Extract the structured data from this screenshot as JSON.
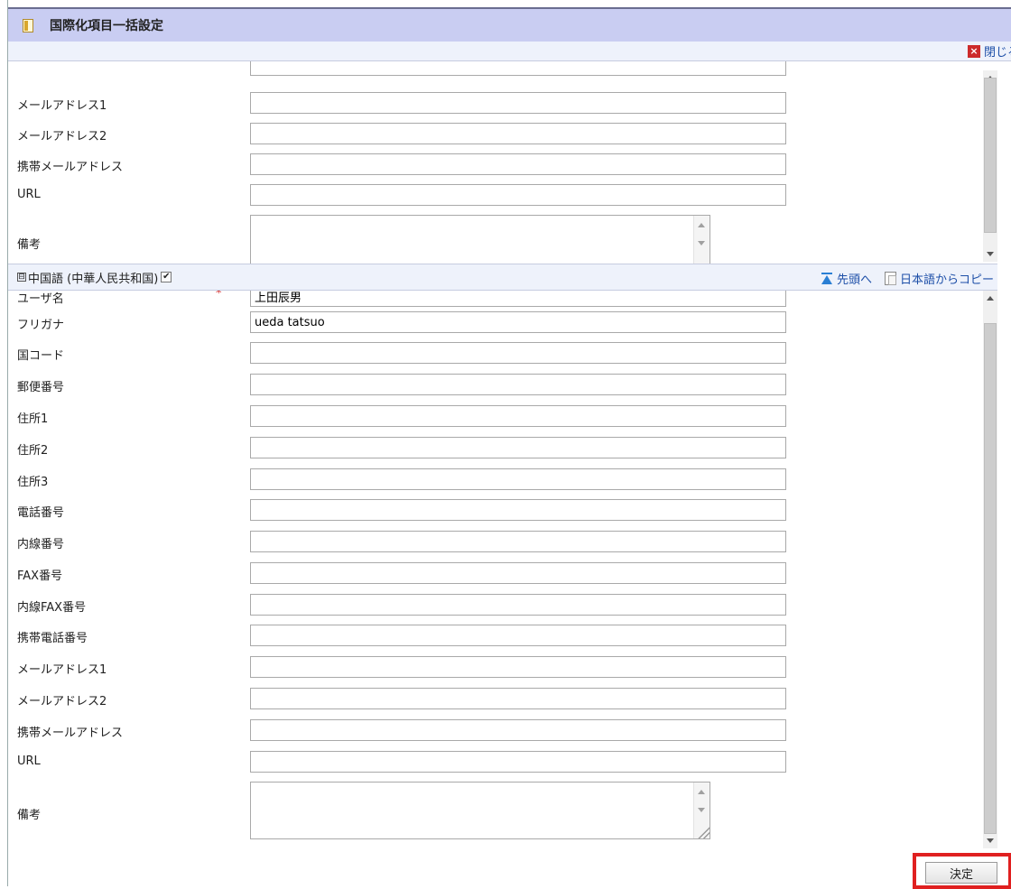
{
  "dialog": {
    "title": "国際化項目一括設定",
    "close_label": "閉じる"
  },
  "upper_fields": [
    {
      "label": "メールアドレス1",
      "value": ""
    },
    {
      "label": "メールアドレス2",
      "value": ""
    },
    {
      "label": "携帯メールアドレス",
      "value": ""
    },
    {
      "label": "URL",
      "value": ""
    }
  ],
  "upper_remark_label": "備考",
  "section": {
    "toggle": "⊟",
    "title": "中国語 (中華人民共和国)",
    "checked": true,
    "top_link": "先頭へ",
    "copy_link": "日本語からコピー"
  },
  "lower_fields": [
    {
      "label": "ユーザ名",
      "value": "上田辰男"
    },
    {
      "label": "フリガナ",
      "value": "ueda tatsuo"
    },
    {
      "label": "国コード",
      "value": ""
    },
    {
      "label": "郵便番号",
      "value": ""
    },
    {
      "label": "住所1",
      "value": ""
    },
    {
      "label": "住所2",
      "value": ""
    },
    {
      "label": "住所3",
      "value": ""
    },
    {
      "label": "電話番号",
      "value": ""
    },
    {
      "label": "内線番号",
      "value": ""
    },
    {
      "label": "FAX番号",
      "value": ""
    },
    {
      "label": "内線FAX番号",
      "value": ""
    },
    {
      "label": "携帯電話番号",
      "value": ""
    },
    {
      "label": "メールアドレス1",
      "value": ""
    },
    {
      "label": "メールアドレス2",
      "value": ""
    },
    {
      "label": "携帯メールアドレス",
      "value": ""
    },
    {
      "label": "URL",
      "value": ""
    }
  ],
  "lower_remark_label": "備考",
  "footer": {
    "ok_label": "決定"
  },
  "colors": {
    "title_bar": "#c9cdf2",
    "link": "#1d4fa8",
    "highlight": "#e02020"
  }
}
